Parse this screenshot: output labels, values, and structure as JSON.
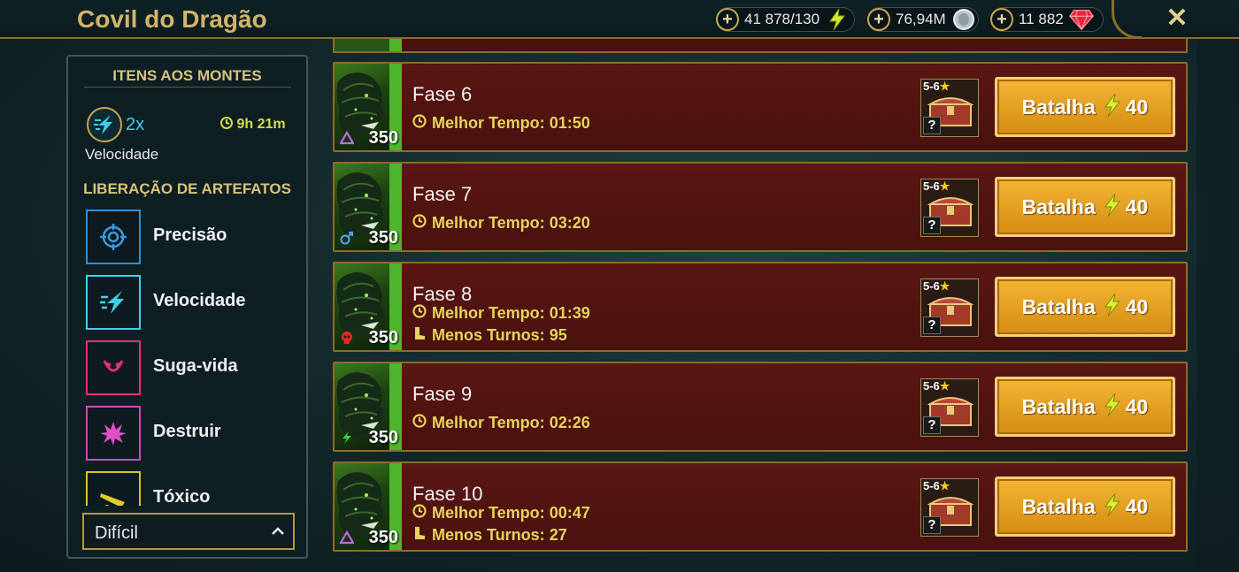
{
  "header": {
    "title": "Covil do Dragão",
    "resources": [
      {
        "name": "energy",
        "value": "41 878/130",
        "icon": "lightning-icon"
      },
      {
        "name": "silver",
        "value": "76,94M",
        "icon": "silver-coin-icon"
      },
      {
        "name": "gems",
        "value": "11 882",
        "icon": "ruby-icon"
      }
    ],
    "close_label": "✕"
  },
  "sidebar": {
    "boost_heading": "ITENS AOS MONTES",
    "boost": {
      "multiplier": "2x",
      "time": "9h 21m",
      "label": "Velocidade"
    },
    "artifacts_heading": "LIBERAÇÃO DE ARTEFATOS",
    "artifacts": [
      {
        "label": "Precisão",
        "icon": "accuracy-icon",
        "color": "#2f8fd6"
      },
      {
        "label": "Velocidade",
        "icon": "speed-icon",
        "color": "#3fd0e8"
      },
      {
        "label": "Suga-vida",
        "icon": "lifesteal-icon",
        "color": "#e0336a"
      },
      {
        "label": "Destruir",
        "icon": "destroy-icon",
        "color": "#d048b8"
      },
      {
        "label": "Tóxico",
        "icon": "toxic-icon",
        "color": "#d8c32a"
      }
    ],
    "difficulty": "Difícil"
  },
  "stages": [
    {
      "name": "Fase 6",
      "power": "350",
      "affinity": "void",
      "best_time_label": "Melhor Tempo:",
      "best_time": "01:50",
      "fewest_turns_label": "",
      "fewest_turns": "",
      "reward_rank": "5-6",
      "reward_unknown": "?",
      "battle_label": "Batalha",
      "battle_cost": "40"
    },
    {
      "name": "Fase 7",
      "power": "350",
      "affinity": "magic",
      "best_time_label": "Melhor Tempo:",
      "best_time": "03:20",
      "fewest_turns_label": "",
      "fewest_turns": "",
      "reward_rank": "5-6",
      "reward_unknown": "?",
      "battle_label": "Batalha",
      "battle_cost": "40"
    },
    {
      "name": "Fase 8",
      "power": "350",
      "affinity": "force",
      "best_time_label": "Melhor Tempo:",
      "best_time": "01:39",
      "fewest_turns_label": "Menos Turnos:",
      "fewest_turns": "95",
      "reward_rank": "5-6",
      "reward_unknown": "?",
      "battle_label": "Batalha",
      "battle_cost": "40"
    },
    {
      "name": "Fase 9",
      "power": "350",
      "affinity": "spirit",
      "best_time_label": "Melhor Tempo:",
      "best_time": "02:26",
      "fewest_turns_label": "",
      "fewest_turns": "",
      "reward_rank": "5-6",
      "reward_unknown": "?",
      "battle_label": "Batalha",
      "battle_cost": "40"
    },
    {
      "name": "Fase 10",
      "power": "350",
      "affinity": "void",
      "best_time_label": "Melhor Tempo:",
      "best_time": "00:47",
      "fewest_turns_label": "Menos Turnos:",
      "fewest_turns": "27",
      "reward_rank": "5-6",
      "reward_unknown": "?",
      "battle_label": "Batalha",
      "battle_cost": "40"
    }
  ]
}
